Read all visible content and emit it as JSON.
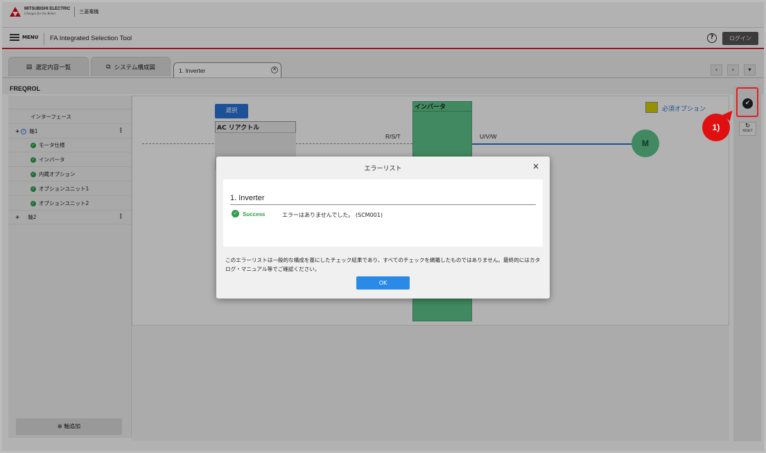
{
  "brand": {
    "logo_line1": "MITSUBISHI ELECTRIC",
    "logo_line2": "Changes for the Better",
    "company_jp": "三菱電機"
  },
  "menubar": {
    "menu_label": "MENU",
    "app_title": "FA Integrated Selection Tool",
    "help_icon": "?",
    "login_label": "ログイン"
  },
  "tabs": [
    {
      "label": "選定内容一覧",
      "icon": "list-icon"
    },
    {
      "label": "システム構成図",
      "icon": "hierarchy-icon"
    },
    {
      "label": "1. Inverter",
      "active": true
    }
  ],
  "tab_nav": {
    "prev": "‹",
    "next": "›",
    "more": "▾"
  },
  "series": "FREQROL",
  "sidebar": {
    "header": "インターフェース",
    "items": [
      {
        "label": "軸1",
        "prefix": "+",
        "kebab": "⋮"
      },
      {
        "label": "モータ仕様"
      },
      {
        "label": "インバータ"
      },
      {
        "label": "内蔵オプション"
      },
      {
        "label": "オプションユニット1"
      },
      {
        "label": "オプションユニット2"
      },
      {
        "label": "軸2",
        "prefix": "+",
        "kebab": "⋮"
      }
    ],
    "add_axis": "軸追加"
  },
  "diagram": {
    "select_label": "選択",
    "ac_reactor": "AC リアクトル",
    "inverter": "インバータ",
    "rst": "R/S/T",
    "uvw": "U/V/W",
    "motor": "M",
    "legend": "必須オプション",
    "legend_color": "#d6d000"
  },
  "rail": {
    "reset_label": "RESET"
  },
  "callout": "1)",
  "dialog": {
    "title": "エラーリスト",
    "close": "×",
    "heading": "1. Inverter",
    "status": "Success",
    "message": "エラーはありませんでした。 (SCM001)",
    "note": "このエラーリストは一般的な構成を基にしたチェック結果であり、すべてのチェックを網羅したものではありません。最終的にはカタログ・マニュアル等でご確認ください。",
    "ok": "OK"
  },
  "colors": {
    "accent_red": "#c9252c",
    "primary_blue": "#2a74d8",
    "success_green": "#2e9e4a",
    "inverter_green": "#5dc48a"
  }
}
